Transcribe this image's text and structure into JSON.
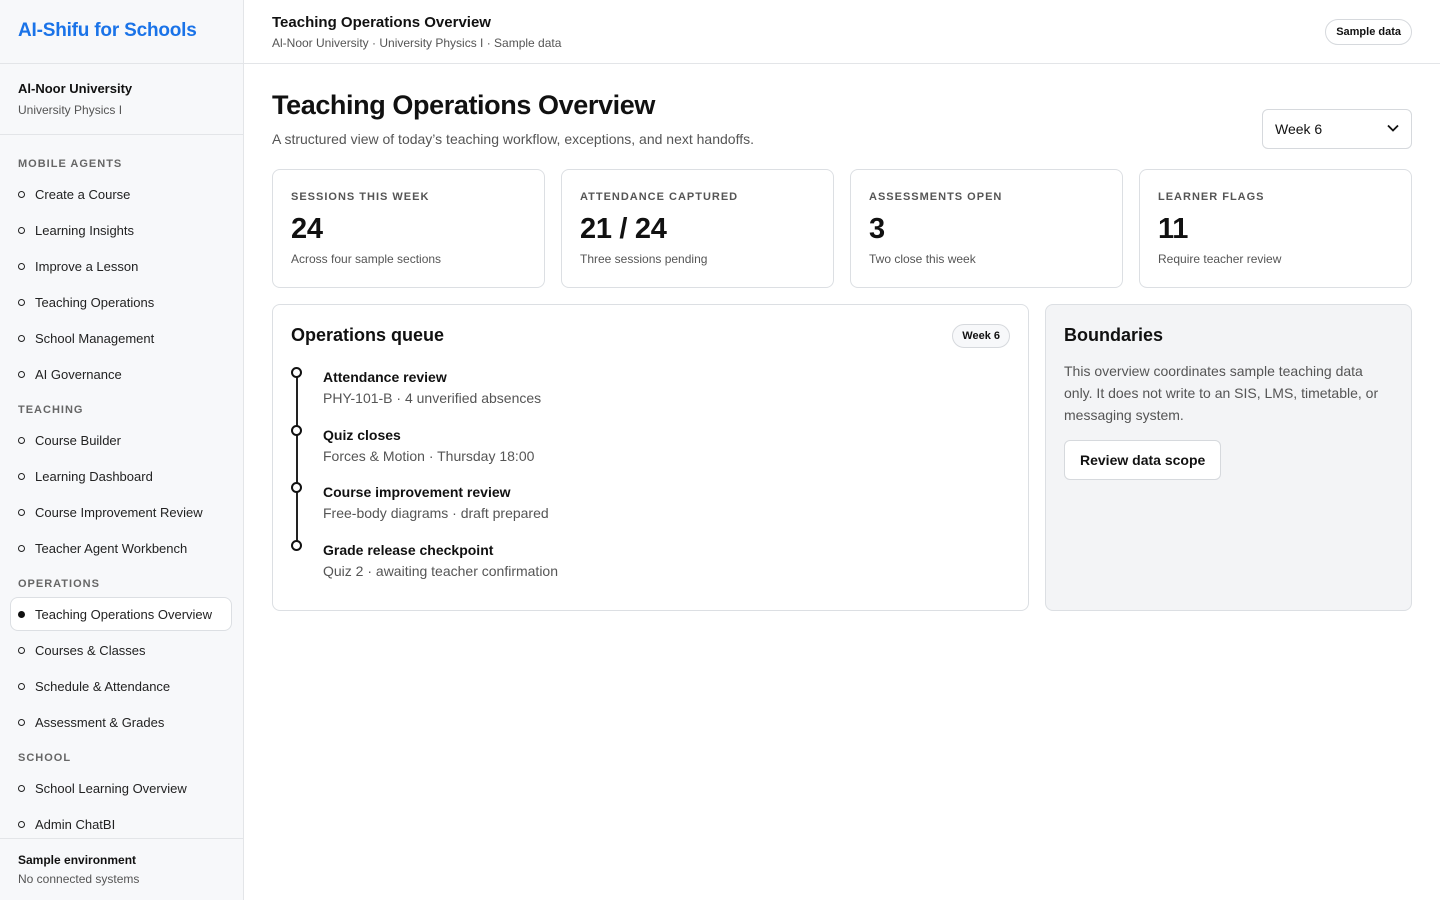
{
  "app": {
    "brand": "AI-Shifu for Schools"
  },
  "org": {
    "name": "Al-Noor University",
    "course": "University Physics I"
  },
  "sidebar": {
    "sections": [
      {
        "title": "Mobile Agents",
        "items": [
          "Create a Course",
          "Learning Insights",
          "Improve a Lesson",
          "Teaching Operations",
          "School Management",
          "AI Governance"
        ]
      },
      {
        "title": "Teaching",
        "items": [
          "Course Builder",
          "Learning Dashboard",
          "Course Improvement Review",
          "Teacher Agent Workbench"
        ]
      },
      {
        "title": "Operations",
        "items": [
          "Teaching Operations Overview",
          "Courses & Classes",
          "Schedule & Attendance",
          "Assessment & Grades"
        ]
      },
      {
        "title": "School",
        "items": [
          "School Learning Overview",
          "Admin ChatBI"
        ]
      }
    ],
    "active": "Teaching Operations Overview",
    "footer": {
      "title": "Sample environment",
      "subtitle": "No connected systems"
    }
  },
  "topbar": {
    "title": "Teaching Operations Overview",
    "breadcrumb": "Al-Noor University · University Physics I · Sample data",
    "badge": "Sample data"
  },
  "main": {
    "title": "Teaching Operations Overview",
    "description": "A structured view of today’s teaching workflow, exceptions, and next handoffs.",
    "week_select": "Week 6",
    "stats": [
      {
        "label": "Sessions this week",
        "value": "24",
        "sub": "Across four sample sections"
      },
      {
        "label": "Attendance captured",
        "value": "21 / 24",
        "sub": "Three sessions pending"
      },
      {
        "label": "Assessments open",
        "value": "3",
        "sub": "Two close this week"
      },
      {
        "label": "Learner flags",
        "value": "11",
        "sub": "Require teacher review"
      }
    ],
    "queue": {
      "title": "Operations queue",
      "badge": "Week 6",
      "items": [
        {
          "title": "Attendance review",
          "sub": "PHY-101-B · 4 unverified absences"
        },
        {
          "title": "Quiz closes",
          "sub": "Forces & Motion · Thursday 18:00"
        },
        {
          "title": "Course improvement review",
          "sub": "Free-body diagrams · draft prepared"
        },
        {
          "title": "Grade release checkpoint",
          "sub": "Quiz 2 · awaiting teacher confirmation"
        }
      ]
    },
    "boundaries": {
      "title": "Boundaries",
      "text": "This overview coordinates sample teaching data only. It does not write to an SIS, LMS, timetable, or messaging system.",
      "button": "Review data scope"
    }
  }
}
